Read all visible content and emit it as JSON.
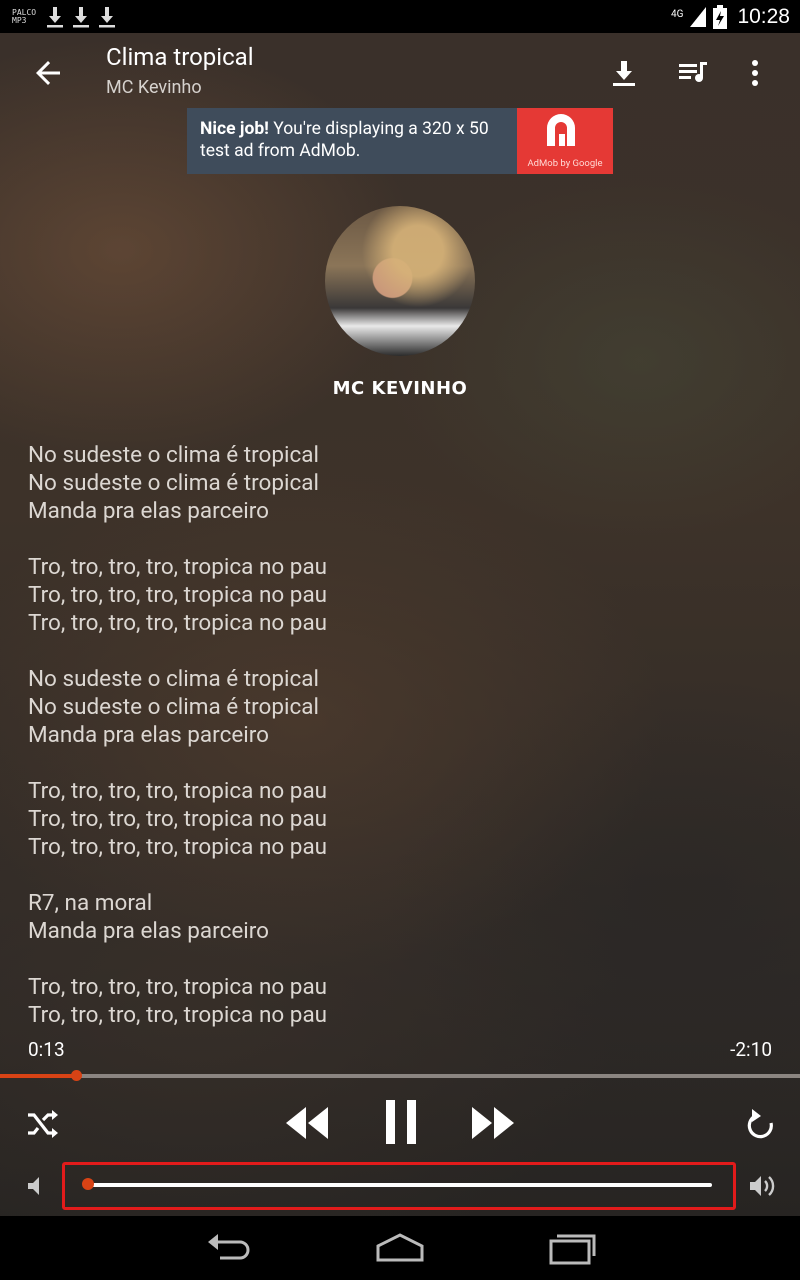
{
  "status_bar": {
    "app_logo_text": "PALCO MP3",
    "network": "4G",
    "time": "10:28"
  },
  "app_bar": {
    "title": "Clima tropical",
    "subtitle": "MC Kevinho"
  },
  "ad": {
    "bold": "Nice job!",
    "text": " You're displaying a 320 x 50 test ad from AdMob.",
    "brand": "AdMob by Google"
  },
  "artist": {
    "name": "MC KEVINHO"
  },
  "lyrics": [
    "No sudeste o clima é tropical",
    "No sudeste o clima é tropical",
    "Manda pra elas parceiro",
    "",
    "Tro, tro, tro, tro, tropica no pau",
    "Tro, tro, tro, tro, tropica no pau",
    "Tro, tro, tro, tro, tropica no pau",
    "",
    "No sudeste o clima é tropical",
    "No sudeste o clima é tropical",
    "Manda pra elas parceiro",
    "",
    "Tro, tro, tro, tro, tropica no pau",
    "Tro, tro, tro, tro, tropica no pau",
    "Tro, tro, tro, tro, tropica no pau",
    "",
    "R7, na moral",
    "Manda pra elas parceiro",
    "",
    "Tro, tro, tro, tro, tropica no pau",
    "Tro, tro, tro, tro, tropica no pau"
  ],
  "playback": {
    "elapsed": "0:13",
    "remaining": "-2:10",
    "progress_fraction": 0.095,
    "volume_fraction": 0.0
  },
  "colors": {
    "accent": "#d84315",
    "highlight_frame": "#e21b1b",
    "ad_bg": "#3f4c5b",
    "ad_logo_bg": "#e53935"
  },
  "icons": {
    "back": "arrow-back-icon",
    "download": "download-icon",
    "queue": "queue-music-icon",
    "more": "more-vert-icon",
    "shuffle": "shuffle-icon",
    "rewind": "rewind-icon",
    "pause": "pause-icon",
    "forward": "fast-forward-icon",
    "repeat": "repeat-icon",
    "volume_low": "volume-low-icon",
    "volume_high": "volume-high-icon"
  }
}
